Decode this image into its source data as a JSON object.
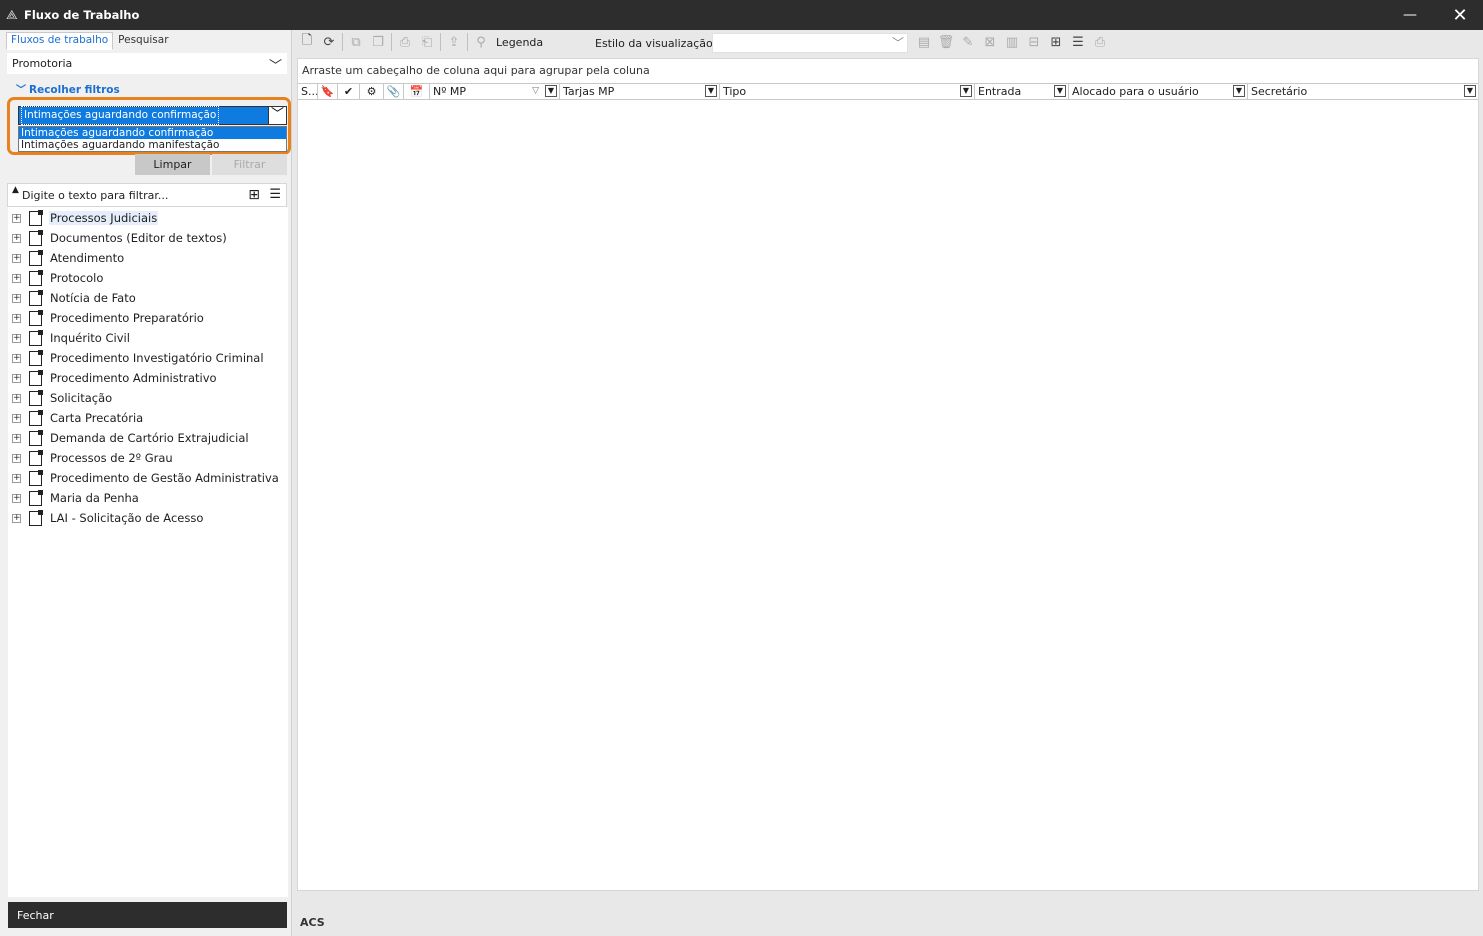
{
  "window": {
    "title": "Fluxo de Trabalho",
    "minimize": "—",
    "close": "✕"
  },
  "left": {
    "tabs": [
      "Fluxos de trabalho",
      "Pesquisar"
    ],
    "org_combo": "Promotoria",
    "collapse_label": "Recolher filtros",
    "dropdown": {
      "selected": "Intimações aguardando confirmação",
      "options": [
        "Intimações aguardando confirmação",
        "Intimações aguardando manifestação"
      ]
    },
    "btn_clear": "Limpar",
    "btn_filter": "Filtrar",
    "filter_placeholder": "Digite o texto para filtrar...",
    "tree": [
      "Processos Judiciais",
      "Documentos (Editor de textos)",
      "Atendimento",
      "Protocolo",
      "Notícia de Fato",
      "Procedimento Preparatório",
      "Inquérito Civil",
      "Procedimento Investigatório Criminal",
      "Procedimento Administrativo",
      "Solicitação",
      "Carta Precatória",
      "Demanda de Cartório Extrajudicial",
      "Processos de 2º Grau",
      "Procedimento de Gestão Administrativa",
      "Maria da Penha",
      "LAI - Solicitação de Acesso"
    ],
    "close_label": "Fechar"
  },
  "toolbar": {
    "legend": "Legenda",
    "style_label": "Estilo da visualização",
    "style_value": ""
  },
  "grid": {
    "group_hint": "Arraste um cabeçalho de coluna aqui para agrupar pela coluna",
    "columns": [
      "S...",
      "Nº MP",
      "Tarjas MP",
      "Tipo",
      "Entrada",
      "Alocado para o usuário",
      "Secretário"
    ]
  },
  "status": "ACS",
  "colors": {
    "accent": "#1c6fd1",
    "highlight": "#e8821e",
    "selection": "#0f7ae0",
    "titlebar": "#2d2d2d"
  }
}
